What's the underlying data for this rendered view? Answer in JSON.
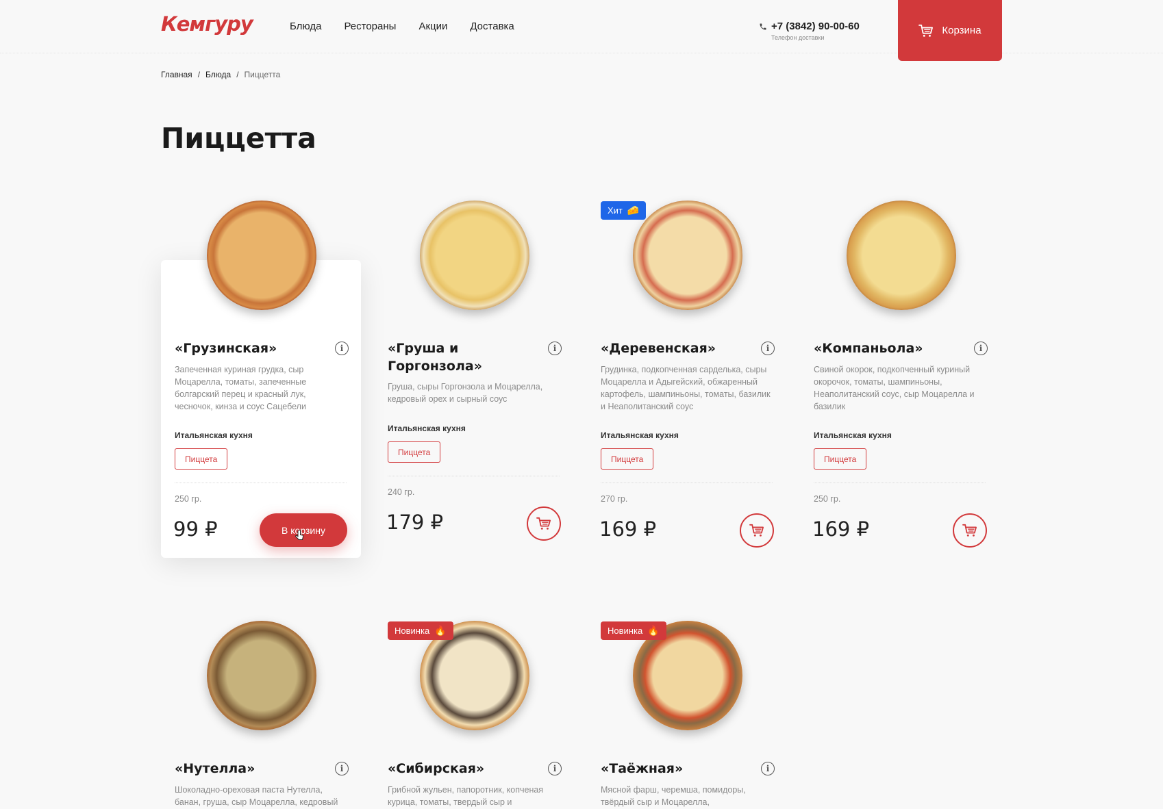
{
  "header": {
    "logo": "Кемгуру",
    "nav": [
      "Блюда",
      "Рестораны",
      "Акции",
      "Доставка"
    ],
    "phone": "+7 (3842) 90-00-60",
    "phone_sub": "Телефон доставки",
    "cart_label": "Корзина",
    "brand_color": "#d2393b"
  },
  "breadcrumb": {
    "items": [
      "Главная",
      "Блюда"
    ],
    "current": "Пиццетта"
  },
  "page_title": "Пиццетта",
  "products": [
    {
      "name": "«Грузинская»",
      "desc": "Запеченная куриная грудка, сыр Моцарелла, томаты, запеченные болгарский перец и красный лук, чесночок, кинза и соус Сацебели",
      "cuisine": "Итальянская кухня",
      "tag": "Пиццета",
      "weight": "250 гр.",
      "price": "99 ₽",
      "add_label": "В корзину"
    },
    {
      "name": "«Груша и Горгонзола»",
      "desc": "Груша, сыры Горгонзола и Моцарелла, кедровый орех и сырный соус",
      "cuisine": "Итальянская кухня",
      "tag": "Пиццета",
      "weight": "240 гр.",
      "price": "179 ₽"
    },
    {
      "name": "«Деревенская»",
      "badge": "Хит",
      "desc": "Грудинка, подкопченная сарделька, сыры Моцарелла и Адыгейский, обжаренный картофель, шампиньоны, томаты, базилик и Неаполитанский соус",
      "cuisine": "Итальянская кухня",
      "tag": "Пиццета",
      "weight": "270 гр.",
      "price": "169 ₽"
    },
    {
      "name": "«Компаньола»",
      "desc": "Свиной окорок, подкопченный куриный окорочок, томаты, шампиньоны, Неаполитанский соус, сыр Моцарелла и базилик",
      "cuisine": "Итальянская кухня",
      "tag": "Пиццета",
      "weight": "250 гр.",
      "price": "169 ₽"
    },
    {
      "name": "«Нутелла»",
      "desc": "Шоколадно-ореховая паста Нутелла, банан, груша, сыр Моцарелла, кедровый"
    },
    {
      "name": "«Сибирская»",
      "badge": "Новинка",
      "desc": "Грибной жульен, папоротник, копченая курица, томаты, твердый сыр и"
    },
    {
      "name": "«Таёжная»",
      "badge": "Новинка",
      "desc": "Мясной фарш, черемша, помидоры, твёрдый сыр и Моцарелла,"
    }
  ],
  "icons": {
    "info": "i",
    "hit_badge": "🧀",
    "new_badge": "🔥"
  }
}
